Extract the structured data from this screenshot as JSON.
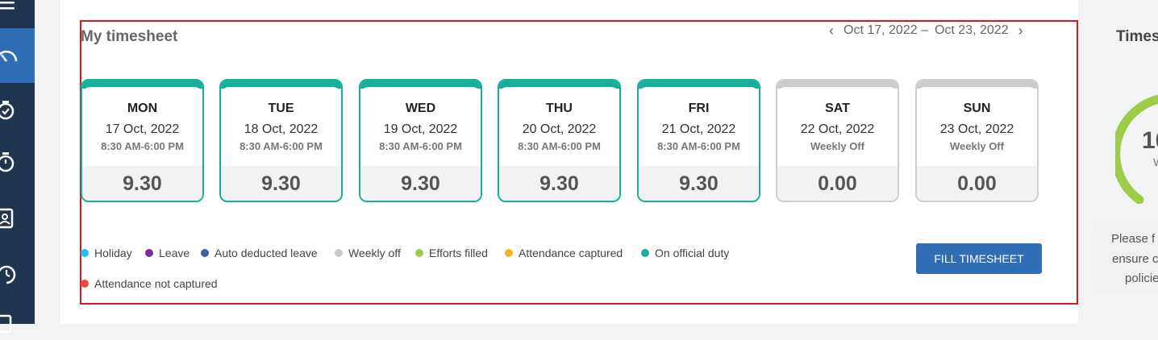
{
  "sidebar": {
    "icons": [
      "menu-icon",
      "dashboard-icon",
      "clock-check-icon",
      "timer-icon",
      "profile-card-icon",
      "refresh-clock-icon",
      "document-icon"
    ]
  },
  "timesheet": {
    "title": "My timesheet",
    "range": {
      "start": "Oct 17, 2022 –",
      "end": "Oct 23, 2022"
    },
    "days": [
      {
        "name": "MON",
        "date": "17 Oct, 2022",
        "shift": "8:30 AM-6:00 PM",
        "hours": "9.30"
      },
      {
        "name": "TUE",
        "date": "18 Oct, 2022",
        "shift": "8:30 AM-6:00 PM",
        "hours": "9.30"
      },
      {
        "name": "WED",
        "date": "19 Oct, 2022",
        "shift": "8:30 AM-6:00 PM",
        "hours": "9.30"
      },
      {
        "name": "THU",
        "date": "20 Oct, 2022",
        "shift": "8:30 AM-6:00 PM",
        "hours": "9.30"
      },
      {
        "name": "FRI",
        "date": "21 Oct, 2022",
        "shift": "8:30 AM-6:00 PM",
        "hours": "9.30"
      },
      {
        "name": "SAT",
        "date": "22 Oct, 2022",
        "shift": "Weekly Off",
        "hours": "0.00"
      },
      {
        "name": "SUN",
        "date": "23 Oct, 2022",
        "shift": "Weekly Off",
        "hours": "0.00"
      }
    ],
    "legend": [
      {
        "label": "Holiday",
        "color": "#1ec0ee"
      },
      {
        "label": "Leave",
        "color": "#7b2e9a"
      },
      {
        "label": "Auto deducted leave",
        "color": "#3d5fa8"
      },
      {
        "label": "Weekly off",
        "color": "#c8c8c8"
      },
      {
        "label": "Efforts filled",
        "color": "#9ccc48"
      },
      {
        "label": "Attendance captured",
        "color": "#f5b31b"
      },
      {
        "label": "On official duty",
        "color": "#14b09c"
      },
      {
        "label": "Attendance not captured",
        "color": "#e84b3c"
      }
    ],
    "fill_button": "FILL TIMESHEET"
  },
  "right_panel": {
    "title": "Times",
    "gauge_value": "10",
    "gauge_sub": "W",
    "info_lines": [
      "Please f",
      "ensure c",
      "policie"
    ]
  },
  "colors": {
    "accent": "#2f6db5",
    "teal": "#16b09a",
    "frame": "#d7191f"
  }
}
